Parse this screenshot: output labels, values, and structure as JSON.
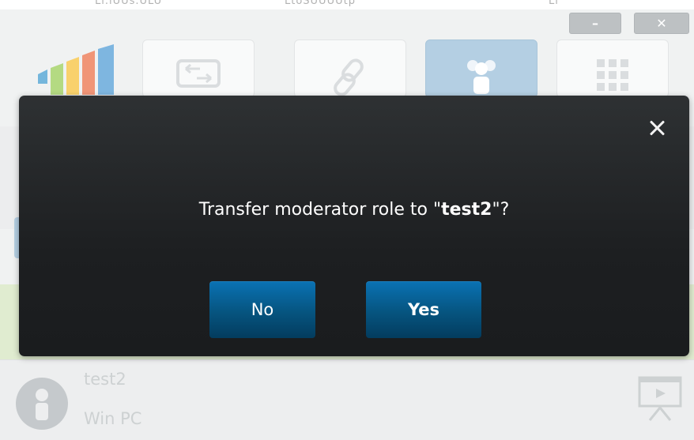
{
  "window": {
    "minimize_glyph": "–",
    "close_glyph": "✕",
    "top_text": [
      "Li.lUUs.ULU",
      "LtoSUUUUtp",
      "Li"
    ]
  },
  "toolbar": {
    "items": [
      {
        "icon": "transfer-icon",
        "active": false
      },
      {
        "icon": "link-icon",
        "active": false
      },
      {
        "icon": "participants-icon",
        "active": true
      },
      {
        "icon": "grid-icon",
        "active": false
      }
    ]
  },
  "participant": {
    "name": "test2",
    "device": "Win PC",
    "icon": "present-screen-icon"
  },
  "dialog": {
    "question_prefix": "Transfer moderator role to \"",
    "question_name": "test2",
    "question_suffix": "\"?",
    "no_label": "No",
    "yes_label": "Yes",
    "close_icon": "close-icon"
  },
  "colors": {
    "dialog_bg": "#1d1f21",
    "button_blue": "#06547f",
    "active_tab": "#8db5d4"
  }
}
